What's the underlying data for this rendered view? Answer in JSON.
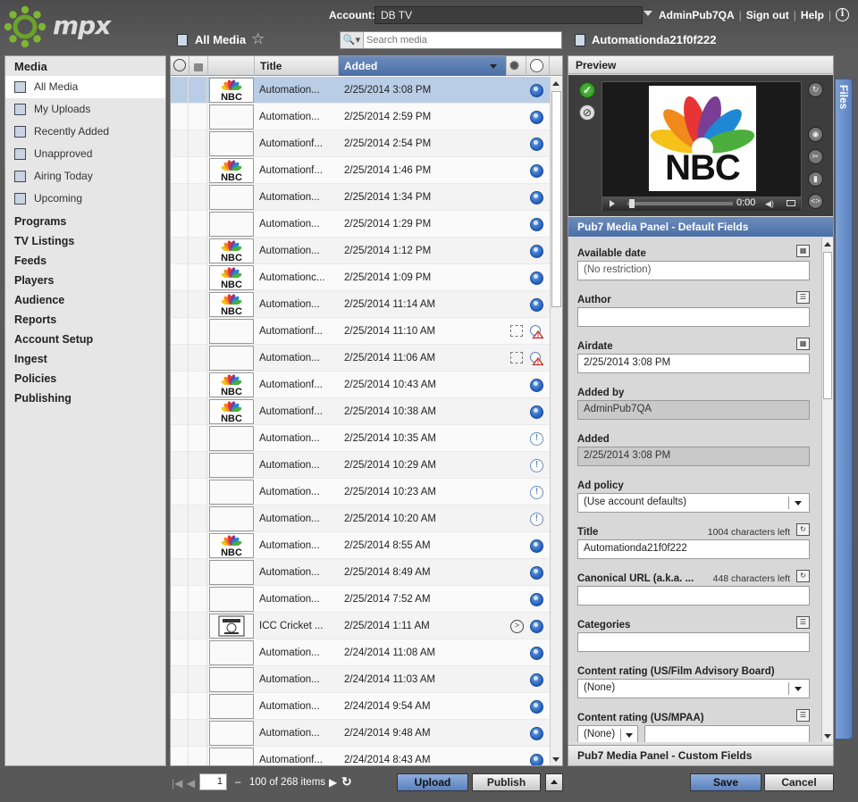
{
  "header": {
    "logo_text": "mpx",
    "account_label": "Account:",
    "account_value": "DB TV",
    "user": "AdminPub7QA",
    "sign_out": "Sign out",
    "help": "Help",
    "sep": "|",
    "info": "i"
  },
  "toolbar": {
    "section_title": "All Media",
    "search_placeholder": "Search media",
    "item_title": "Automationda21f0f222"
  },
  "nav": {
    "heading": "Media",
    "media_items": [
      {
        "label": "All Media",
        "active": true
      },
      {
        "label": "My Uploads"
      },
      {
        "label": "Recently Added"
      },
      {
        "label": "Unapproved"
      },
      {
        "label": "Airing Today"
      },
      {
        "label": "Upcoming"
      }
    ],
    "sections": [
      "Programs",
      "TV Listings",
      "Feeds",
      "Players",
      "Audience",
      "Reports",
      "Account Setup",
      "Ingest",
      "Policies",
      "Publishing"
    ]
  },
  "list": {
    "columns": {
      "title": "Title",
      "added": "Added"
    },
    "rows": [
      {
        "title": "Automation...",
        "added": "2/25/2014 3:08 PM",
        "thumb": "nbc",
        "status": "globe",
        "selected": true
      },
      {
        "title": "Automation...",
        "added": "2/25/2014 2:59 PM",
        "thumb": "blank",
        "status": "globe"
      },
      {
        "title": "Automationf...",
        "added": "2/25/2014 2:54 PM",
        "thumb": "blank",
        "status": "globe"
      },
      {
        "title": "Automationf...",
        "added": "2/25/2014 1:46 PM",
        "thumb": "nbc",
        "status": "globe"
      },
      {
        "title": "Automation...",
        "added": "2/25/2014 1:34 PM",
        "thumb": "blank",
        "status": "globe"
      },
      {
        "title": "Automation...",
        "added": "2/25/2014 1:29 PM",
        "thumb": "blank",
        "status": "globe"
      },
      {
        "title": "Automation...",
        "added": "2/25/2014 1:12 PM",
        "thumb": "nbc",
        "status": "globe"
      },
      {
        "title": "Automationc...",
        "added": "2/25/2014 1:09 PM",
        "thumb": "nbc",
        "status": "globe"
      },
      {
        "title": "Automation...",
        "added": "2/25/2014 11:14 AM",
        "thumb": "nbc",
        "status": "globe"
      },
      {
        "title": "Automationf...",
        "added": "2/25/2014 11:10 AM",
        "thumb": "blank",
        "status": "warn",
        "extra": "dashed"
      },
      {
        "title": "Automation...",
        "added": "2/25/2014 11:06 AM",
        "thumb": "blank",
        "status": "warn",
        "extra": "dashed"
      },
      {
        "title": "Automationf...",
        "added": "2/25/2014 10:43 AM",
        "thumb": "nbc",
        "status": "globe"
      },
      {
        "title": "Automationf...",
        "added": "2/25/2014 10:38 AM",
        "thumb": "nbc",
        "status": "globe"
      },
      {
        "title": "Automation...",
        "added": "2/25/2014 10:35 AM",
        "thumb": "blank",
        "status": "pending"
      },
      {
        "title": "Automation...",
        "added": "2/25/2014 10:29 AM",
        "thumb": "blank",
        "status": "pending"
      },
      {
        "title": "Automation...",
        "added": "2/25/2014 10:23 AM",
        "thumb": "blank",
        "status": "pending"
      },
      {
        "title": "Automation...",
        "added": "2/25/2014 10:20 AM",
        "thumb": "blank",
        "status": "pending"
      },
      {
        "title": "Automation...",
        "added": "2/25/2014 8:55 AM",
        "thumb": "nbc",
        "status": "globe"
      },
      {
        "title": "Automation...",
        "added": "2/25/2014 8:49 AM",
        "thumb": "blank",
        "status": "globe"
      },
      {
        "title": "Automation...",
        "added": "2/25/2014 7:52 AM",
        "thumb": "blank",
        "status": "globe"
      },
      {
        "title": "ICC Cricket ...",
        "added": "2/25/2014 1:11 AM",
        "thumb": "cricket",
        "status": "globe",
        "extra": "arrow"
      },
      {
        "title": "Automation...",
        "added": "2/24/2014 11:08 AM",
        "thumb": "blank",
        "status": "globe"
      },
      {
        "title": "Automation...",
        "added": "2/24/2014 11:03 AM",
        "thumb": "blank",
        "status": "globe"
      },
      {
        "title": "Automation...",
        "added": "2/24/2014 9:54 AM",
        "thumb": "blank",
        "status": "globe"
      },
      {
        "title": "Automation...",
        "added": "2/24/2014 9:48 AM",
        "thumb": "blank",
        "status": "globe"
      },
      {
        "title": "Automationf...",
        "added": "2/24/2014 8:43 AM",
        "thumb": "blank",
        "status": "globe"
      }
    ]
  },
  "preview": {
    "heading": "Preview",
    "time": "0:00",
    "nbc_wordmark": "NBC"
  },
  "panel": {
    "heading": "Pub7 Media Panel - Default Fields",
    "custom_heading": "Pub7 Media Panel - Custom Fields",
    "files_tab": "Files",
    "fields": {
      "available_date": {
        "label": "Available date",
        "value": "(No restriction)"
      },
      "author": {
        "label": "Author",
        "value": ""
      },
      "airdate": {
        "label": "Airdate",
        "value": "2/25/2014 3:08 PM"
      },
      "added_by": {
        "label": "Added by",
        "value": "AdminPub7QA"
      },
      "added": {
        "label": "Added",
        "value": "2/25/2014 3:08 PM"
      },
      "ad_policy": {
        "label": "Ad policy",
        "value": "(Use account defaults)"
      },
      "title": {
        "label": "Title",
        "count": "1004 characters left",
        "value": "Automationda21f0f222"
      },
      "canonical_url": {
        "label": "Canonical URL (a.k.a. ...",
        "count": "448 characters left",
        "value": ""
      },
      "categories": {
        "label": "Categories",
        "value": ""
      },
      "rating_film": {
        "label": "Content rating (US/Film Advisory Board)",
        "value": "(None)"
      },
      "rating_mpaa": {
        "label": "Content rating (US/MPAA)",
        "value": "(None)"
      }
    }
  },
  "footer": {
    "page": "1",
    "dash": "–",
    "range": "100 of 268 items",
    "upload": "Upload",
    "publish": "Publish",
    "save": "Save",
    "cancel": "Cancel"
  },
  "colors": {
    "accent_blue": "#4b6fa6",
    "selected_row": "#b9cde6",
    "globe": "#1f5dbb"
  }
}
